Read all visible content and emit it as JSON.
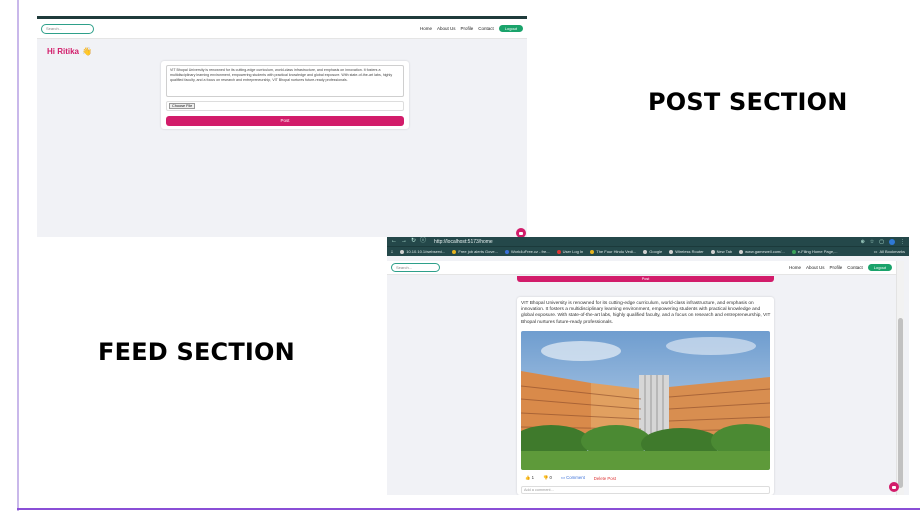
{
  "post_screen": {
    "search_placeholder": "Search...",
    "nav_links": [
      "Home",
      "About Us",
      "Profile",
      "Contact"
    ],
    "logout_label": "Logout",
    "greeting": "Hi Ritika",
    "greeting_emoji": "👋",
    "post_text": "VIT Bhopal University is renowned for its cutting-edge curriculum, world-class infrastructure, and emphasis on innovation. It fosters a multidisciplinary learning environment, empowering students with practical knowledge and global exposure. With state-of-the-art labs, highly qualified faculty, and a focus on research and entrepreneurship, VIT Bhopal nurtures future-ready professionals.",
    "choose_file_label": "Choose File",
    "post_button": "Post"
  },
  "labels": {
    "post_section": "POST SECTION",
    "feed_section": "FEED SECTION"
  },
  "feed_screen": {
    "url": "http://localhost:5173/home",
    "bookmarks": [
      {
        "label": "10.10.10.1/webservi...",
        "color": "grey"
      },
      {
        "label": "Free job alerts Gove...",
        "color": "yel"
      },
      {
        "label": "Work4uFree.cz - fre...",
        "color": "blue"
      },
      {
        "label": "User Log In",
        "color": "red"
      },
      {
        "label": "The Four Hindu Vedi...",
        "color": "yel"
      },
      {
        "label": "Google",
        "color": "grey"
      },
      {
        "label": "Wireless Router",
        "color": "grey"
      },
      {
        "label": "New Tab",
        "color": "grey"
      },
      {
        "label": "www.gamewell.com/...",
        "color": "grey"
      },
      {
        "label": "e-Filing Home Page,...",
        "color": "green"
      }
    ],
    "all_bookmarks": "All Bookmarks",
    "search_placeholder": "Search...",
    "nav_links": [
      "Home",
      "About Us",
      "Profile",
      "Contact"
    ],
    "logout_label": "Logout",
    "post_button": "Post",
    "feed_text": "VIT Bhopal University is renowned for its cutting-edge curriculum, world-class infrastructure, and emphasis on innovation. It fosters a multidisciplinary learning environment, empowering students with practical knowledge and global exposure. With state-of-the-art labs, highly qualified faculty, and a focus on research and entrepreneurship, VIT Bhopal nurtures future-ready professionals.",
    "likes": "1",
    "dislikes": "0",
    "comment_label": "Comment",
    "delete_label": "Delete Post",
    "comment_placeholder": "Add a comment..."
  },
  "colors": {
    "accent": "#d21c6a",
    "logout_green": "#1aa36b",
    "browser_chrome": "#24484a"
  }
}
